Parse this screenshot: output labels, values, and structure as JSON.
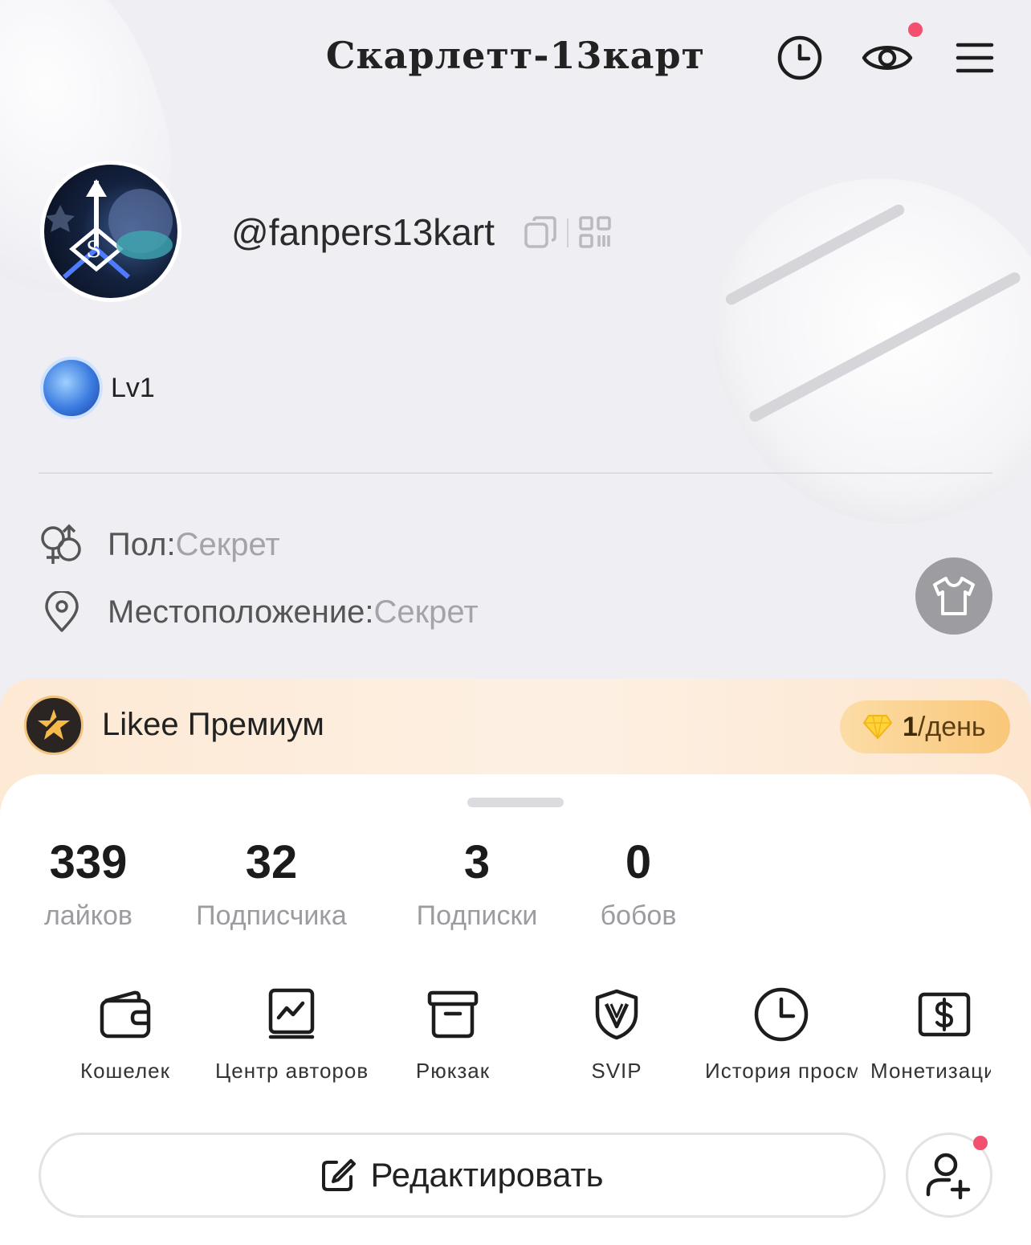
{
  "header": {
    "title": "Скарлетт-13карт",
    "icons": [
      "clock-icon",
      "eye-icon",
      "menu-icon"
    ],
    "notification_dot_color": "#f2506e"
  },
  "profile": {
    "username": "@fanpers13kart",
    "level": "Lv1",
    "info": [
      {
        "label": "Пол:",
        "value": "Секрет",
        "icon": "gender-icon"
      },
      {
        "label": "Местоположение:",
        "value": "Секрет",
        "icon": "location-pin-icon"
      }
    ]
  },
  "premium": {
    "title": "Likee Премиум",
    "pill_count": "1",
    "pill_unit": "/день"
  },
  "stats": [
    {
      "value": "339",
      "label": "лайков"
    },
    {
      "value": "32",
      "label": "Подписчика"
    },
    {
      "value": "3",
      "label": "Подписки"
    },
    {
      "value": "0",
      "label": "бобов"
    }
  ],
  "tools": [
    {
      "label": "Кошелек",
      "icon": "wallet-icon"
    },
    {
      "label": "Центр авторов",
      "icon": "creator-center-icon"
    },
    {
      "label": "Рюкзак",
      "icon": "backpack-icon"
    },
    {
      "label": "SVIP",
      "icon": "svip-icon"
    },
    {
      "label": "История просмотров",
      "icon": "history-icon"
    },
    {
      "label": "Монетизация",
      "icon": "monetization-icon"
    }
  ],
  "actions": {
    "edit_label": "Редактировать"
  }
}
